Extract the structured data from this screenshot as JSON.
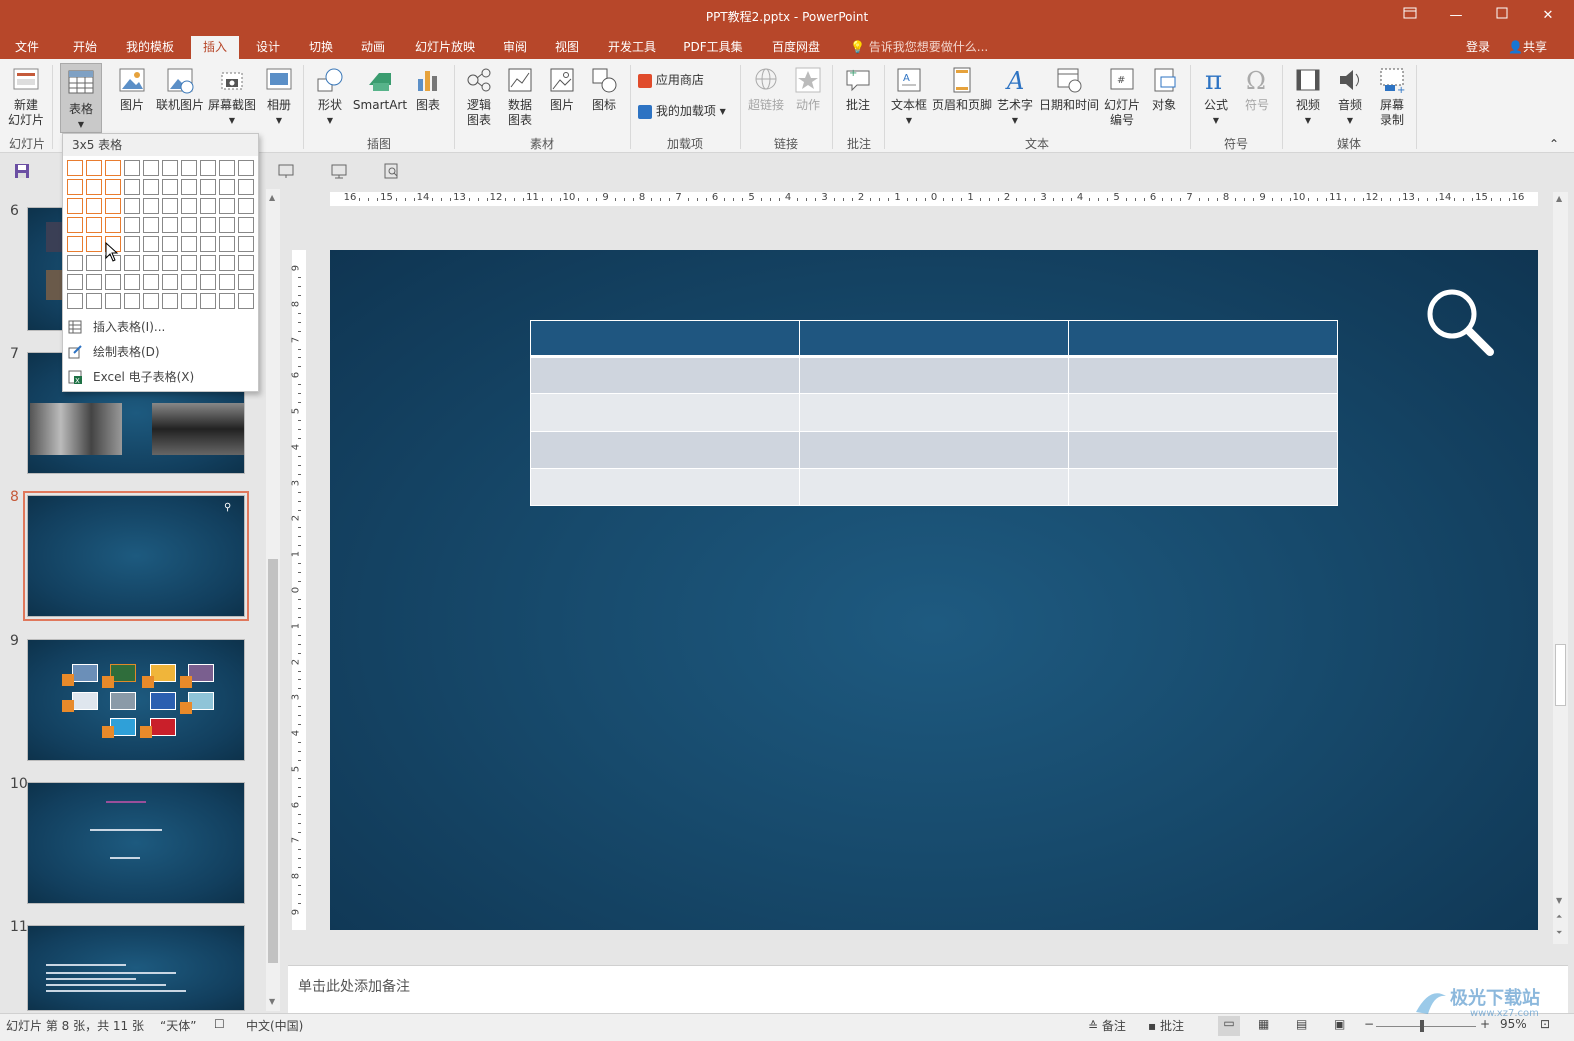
{
  "window": {
    "title": "PPT教程2.pptx - PowerPoint"
  },
  "tabs": [
    "文件",
    "开始",
    "我的模板",
    "插入",
    "设计",
    "切换",
    "动画",
    "幻灯片放映",
    "审阅",
    "视图",
    "开发工具",
    "PDF工具集",
    "百度网盘"
  ],
  "active_tab": "插入",
  "tell_me": "告诉我您想要做什么...",
  "account": {
    "login": "登录",
    "share": "共享"
  },
  "ribbon": {
    "new_slide_l1": "新建",
    "new_slide_l2": "幻灯片",
    "table": "表格",
    "picture": "图片",
    "online_picture": "联机图片",
    "screenshot": "屏幕截图",
    "album": "相册",
    "shapes": "形状",
    "smartart": "SmartArt",
    "chart": "图表",
    "logic_chart_l1": "逻辑",
    "logic_chart_l2": "图表",
    "data_chart_l1": "数据",
    "data_chart_l2": "图表",
    "material_picture": "图片",
    "icon": "图标",
    "app_store": "应用商店",
    "my_addins": "我的加载项",
    "hyperlink": "超链接",
    "action": "动作",
    "comment": "批注",
    "textbox": "文本框",
    "header_footer": "页眉和页脚",
    "wordart": "艺术字",
    "datetime": "日期和时间",
    "slide_number_l1": "幻灯片",
    "slide_number_l2": "编号",
    "object": "对象",
    "equation": "公式",
    "symbol": "符号",
    "video": "视频",
    "audio": "音频",
    "screen_rec_l1": "屏幕",
    "screen_rec_l2": "录制",
    "groups": {
      "slides": "幻灯片",
      "illustrations": "插图",
      "material": "素材",
      "addins": "加载项",
      "links": "链接",
      "comments": "批注",
      "text": "文本",
      "symbols": "符号",
      "media": "媒体"
    }
  },
  "table_dropdown": {
    "header": "3x5 表格",
    "grid_cols": 10,
    "grid_rows": 8,
    "highlight_cols": 3,
    "highlight_rows": 5,
    "items": [
      "插入表格(I)...",
      "绘制表格(D)",
      "Excel 电子表格(X)"
    ]
  },
  "slides": [
    {
      "num": "6"
    },
    {
      "num": "7"
    },
    {
      "num": "8"
    },
    {
      "num": "9"
    },
    {
      "num": "10"
    },
    {
      "num": "11"
    }
  ],
  "selected_slide": "8",
  "ruler_h": [
    "16",
    "15",
    "14",
    "13",
    "12",
    "11",
    "10",
    "9",
    "8",
    "7",
    "6",
    "5",
    "4",
    "3",
    "2",
    "1",
    "0",
    "1",
    "2",
    "3",
    "4",
    "5",
    "6",
    "7",
    "8",
    "9",
    "10",
    "11",
    "12",
    "13",
    "14",
    "15",
    "16"
  ],
  "ruler_v": [
    "9",
    "8",
    "7",
    "6",
    "5",
    "4",
    "3",
    "2",
    "1",
    "0",
    "1",
    "2",
    "3",
    "4",
    "5",
    "6",
    "7",
    "8",
    "9"
  ],
  "notes_placeholder": "单击此处添加备注",
  "status": {
    "slide_info": "幻灯片 第 8 张，共 11 张",
    "theme": "“天体”",
    "language": "中文(中国)",
    "notes": "备注",
    "comments": "批注",
    "zoom": "95%"
  },
  "watermark": {
    "brand": "极光下载站",
    "url": "www.xz7.com"
  },
  "colors": {
    "accent": "#b7472a",
    "slide_bg": "#174a6c",
    "table_header": "#1f5680",
    "grid_highlight": "#e87c2f"
  }
}
